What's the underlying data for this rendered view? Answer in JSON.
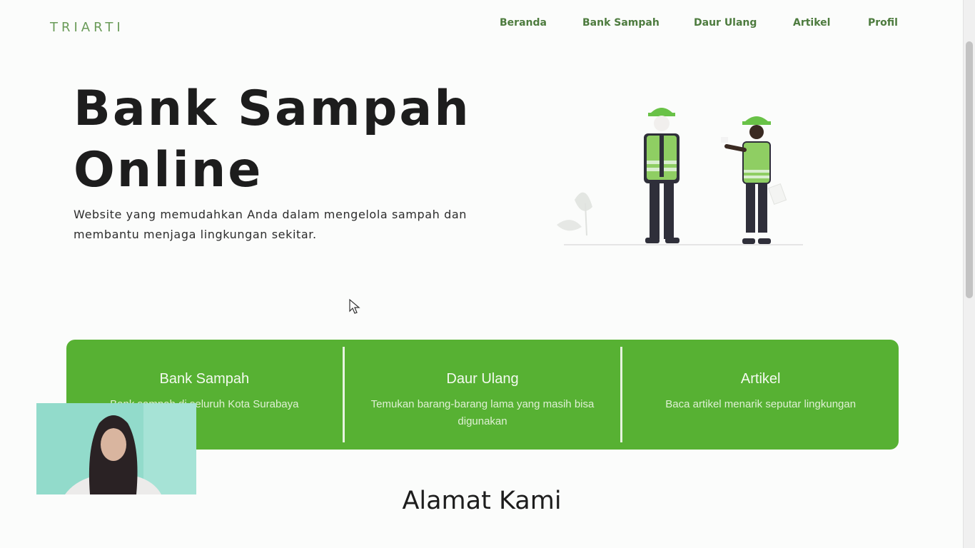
{
  "brand": "TRIARTI",
  "nav": {
    "items": [
      "Beranda",
      "Bank Sampah",
      "Daur Ulang",
      "Artikel",
      "Profil"
    ]
  },
  "hero": {
    "title_line1": "Bank Sampah",
    "title_line2": "Online",
    "subtitle": "Website yang memudahkan Anda dalam mengelola sampah dan membantu menjaga lingkungan sekitar."
  },
  "cards": [
    {
      "title": "Bank Sampah",
      "desc": "Bank sampah di seluruh Kota Surabaya"
    },
    {
      "title": "Daur Ulang",
      "desc": "Temukan barang-barang lama yang masih bisa digunakan"
    },
    {
      "title": "Artikel",
      "desc": "Baca artikel menarik seputar lingkungan"
    }
  ],
  "section": {
    "title": "Alamat Kami"
  },
  "colors": {
    "accent": "#57b133",
    "brand": "#6a9b58",
    "nav": "#4d7b3e"
  },
  "icons": {
    "cursor": "pointer-cursor-icon",
    "illustration": "recycling-workers-illustration"
  }
}
